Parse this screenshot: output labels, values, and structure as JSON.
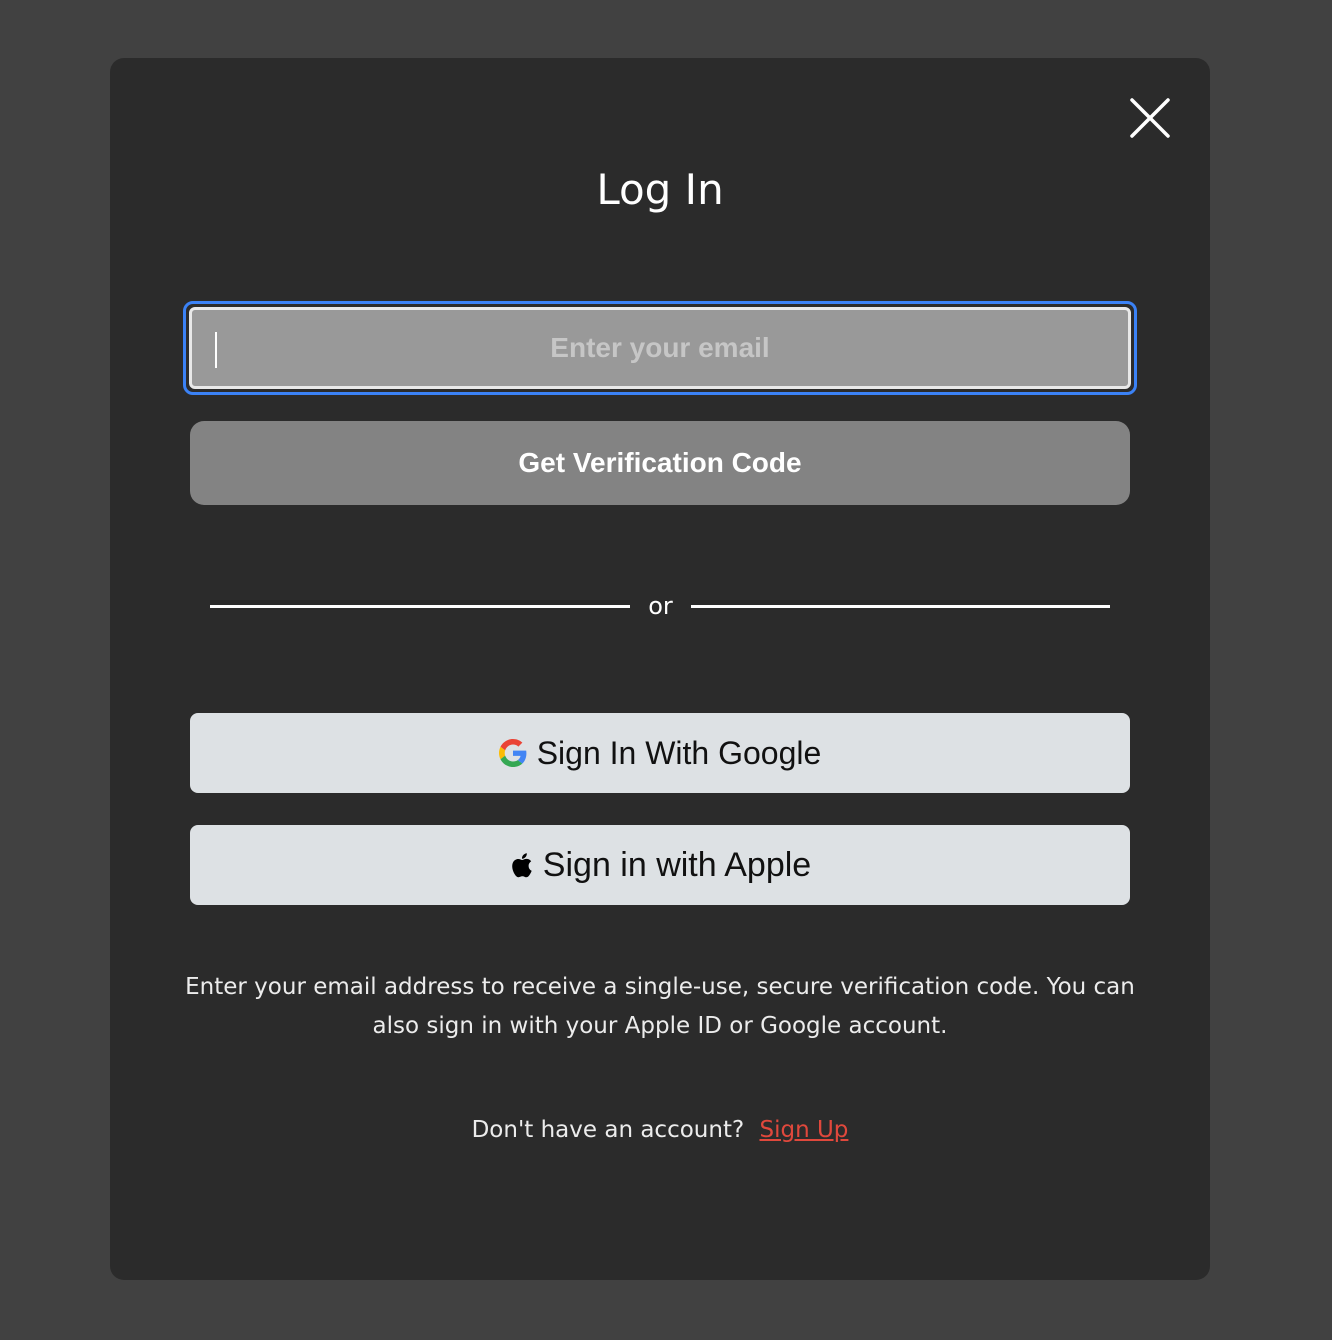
{
  "modal": {
    "title": "Log In",
    "close_icon": "close-icon"
  },
  "email": {
    "placeholder": "Enter your email",
    "value": ""
  },
  "verify_button": {
    "label": "Get Verification Code"
  },
  "divider": {
    "label": "or"
  },
  "google_button": {
    "label": "Sign In With Google",
    "icon": "google-logo-icon"
  },
  "apple_button": {
    "label": "Sign in with Apple",
    "icon": "apple-logo-icon"
  },
  "help": {
    "text": "Enter your email address to receive a single-use, secure verification code. You can also sign in with your Apple ID or Google account."
  },
  "signup": {
    "prompt": "Don't have an account?",
    "link_label": "Sign Up"
  },
  "colors": {
    "backdrop": "#414141",
    "modal_bg": "#2b2b2b",
    "focus_ring": "#3b82f6",
    "link": "#e0483c",
    "social_bg": "#dde1e4"
  }
}
